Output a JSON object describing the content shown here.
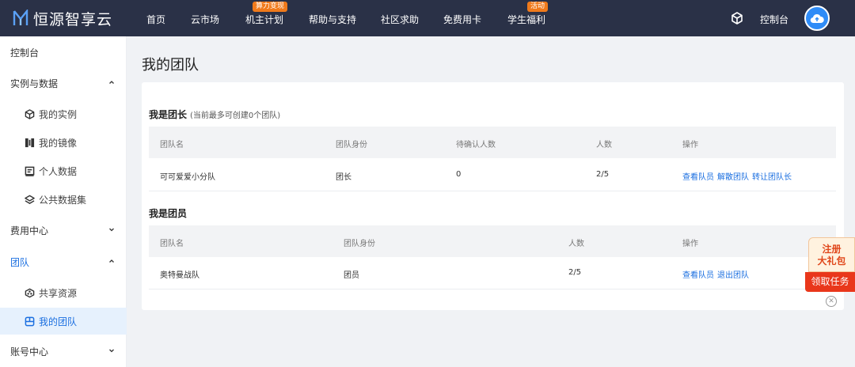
{
  "header": {
    "brand": "恒源智享云",
    "nav": [
      {
        "label": "首页"
      },
      {
        "label": "云市场"
      },
      {
        "label": "机主计划",
        "badge": "算力变现"
      },
      {
        "label": "帮助与支持"
      },
      {
        "label": "社区求助"
      },
      {
        "label": "免费用卡"
      },
      {
        "label": "学生福利",
        "badge": "活动"
      }
    ],
    "console": "控制台",
    "cube_icon": "cube-icon",
    "avatar_icon": "cloud-upload-icon"
  },
  "sidebar": {
    "console": "控制台",
    "groups": [
      {
        "label": "实例与数据",
        "expanded": true,
        "items": [
          {
            "label": "我的实例",
            "icon": "cube-icon"
          },
          {
            "label": "我的镜像",
            "icon": "image-icon"
          },
          {
            "label": "个人数据",
            "icon": "data-icon"
          },
          {
            "label": "公共数据集",
            "icon": "layers-icon"
          }
        ]
      },
      {
        "label": "费用中心",
        "expanded": false,
        "items": []
      },
      {
        "label": "团队",
        "expanded": true,
        "items": [
          {
            "label": "共享资源",
            "icon": "share-icon"
          },
          {
            "label": "我的团队",
            "icon": "team-icon",
            "active": true
          }
        ]
      },
      {
        "label": "账号中心",
        "expanded": false,
        "items": []
      }
    ]
  },
  "main": {
    "title": "我的团队",
    "leader_section": {
      "title": "我是团长",
      "hint": "(当前最多可创建0个团队)",
      "columns": [
        "团队名",
        "团队身份",
        "待确认人数",
        "人数",
        "操作"
      ],
      "rows": [
        {
          "name": "可可爱爱小分队",
          "role": "团长",
          "pending": "0",
          "count": "2/5",
          "actions": [
            "查看队员",
            "解散团队",
            "转让团队长"
          ]
        }
      ]
    },
    "member_section": {
      "title": "我是团员",
      "columns": [
        "团队名",
        "团队身份",
        "人数",
        "操作"
      ],
      "rows": [
        {
          "name": "奥特曼战队",
          "role": "团员",
          "count": "2/5",
          "actions": [
            "查看队员",
            "退出团队"
          ]
        }
      ]
    }
  },
  "promo": {
    "line1": "注册",
    "line2": "大礼包",
    "button": "领取任务",
    "close": "✕"
  },
  "colors": {
    "topbar": "#2a3147",
    "accent": "#1b6fe0",
    "badge": "#f07a1b",
    "promo": "#e9371b"
  }
}
